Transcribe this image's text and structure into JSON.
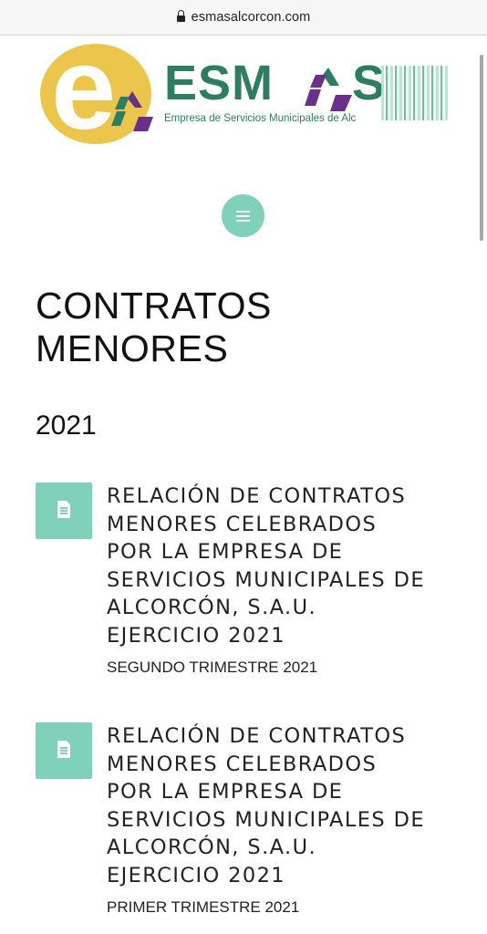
{
  "browser": {
    "url": "esmasalcorcon.com",
    "lock_icon": "lock-icon"
  },
  "logo": {
    "name": "ESMASE",
    "subtitle": "Empresa de Servicios Municipales de Alcorcón",
    "colors": {
      "yellow": "#ecc64c",
      "green": "#2e7d62",
      "purple": "#6b2f8a"
    }
  },
  "nav": {
    "menu_icon": "hamburger-menu-icon",
    "button_color": "#7fd1b9"
  },
  "page": {
    "title_line1": "CONTRATOS",
    "title_line2": "MENORES",
    "year": "2021"
  },
  "documents": [
    {
      "icon": "document-icon",
      "title_lines": [
        "RELACIÓN DE CONTRATOS",
        "MENORES CELEBRADOS",
        "POR LA EMPRESA DE",
        "SERVICIOS MUNICIPALES DE",
        "ALCORCÓN, S.A.U.",
        "EJERCICIO 2021"
      ],
      "subtitle": "SEGUNDO TRIMESTRE 2021"
    },
    {
      "icon": "document-icon",
      "title_lines": [
        "RELACIÓN DE CONTRATOS",
        "MENORES CELEBRADOS",
        "POR LA EMPRESA DE",
        "SERVICIOS MUNICIPALES DE",
        "ALCORCÓN, S.A.U.",
        "EJERCICIO 2021"
      ],
      "subtitle": "PRIMER TRIMESTRE 2021"
    }
  ]
}
